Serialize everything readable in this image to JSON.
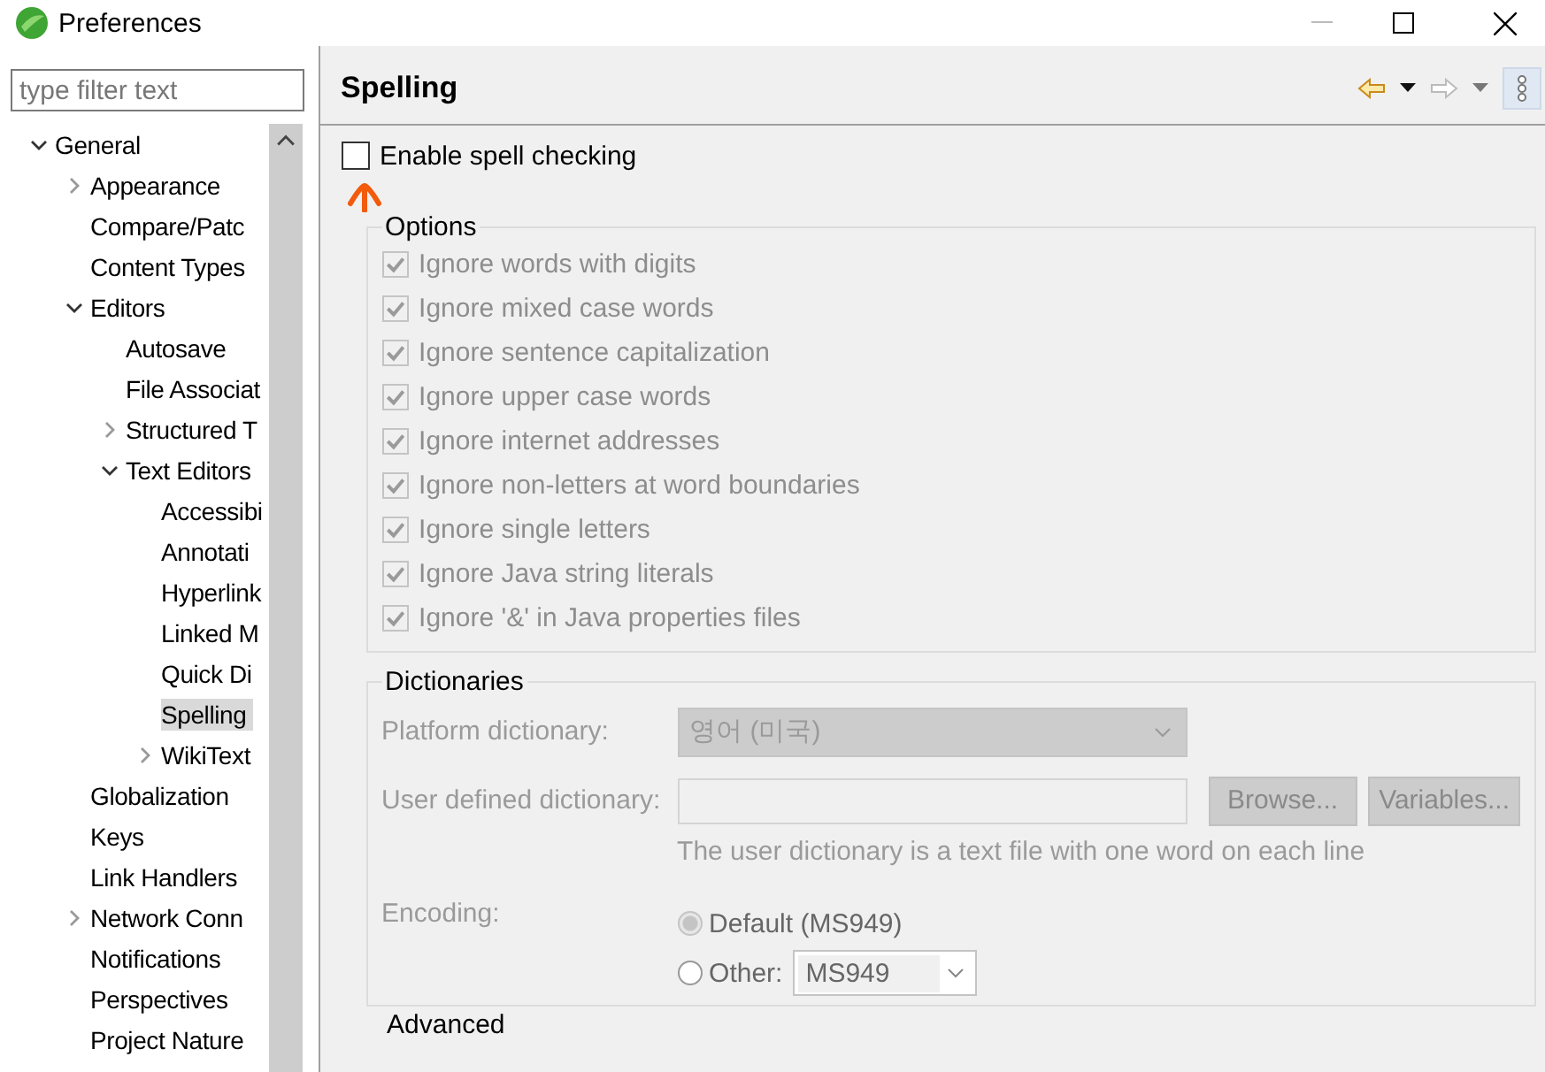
{
  "window": {
    "title": "Preferences"
  },
  "filter": {
    "placeholder": "type filter text"
  },
  "tree": [
    {
      "label": "General",
      "expanded": true,
      "selected": false,
      "children": [
        {
          "label": "Appearance",
          "expanded": false,
          "selected": false
        },
        {
          "label": "Compare/Patc",
          "selected": false
        },
        {
          "label": "Content Types",
          "selected": false
        },
        {
          "label": "Editors",
          "expanded": true,
          "selected": false,
          "children": [
            {
              "label": "Autosave",
              "selected": false
            },
            {
              "label": "File Associat",
              "selected": false
            },
            {
              "label": "Structured T",
              "expanded": false,
              "selected": false
            },
            {
              "label": "Text Editors",
              "expanded": true,
              "selected": false,
              "children": [
                {
                  "label": "Accessibi",
                  "selected": false
                },
                {
                  "label": "Annotati",
                  "selected": false
                },
                {
                  "label": "Hyperlink",
                  "selected": false
                },
                {
                  "label": "Linked M",
                  "selected": false
                },
                {
                  "label": "Quick Di",
                  "selected": false
                },
                {
                  "label": "Spelling",
                  "selected": true
                },
                {
                  "label": "WikiText",
                  "expanded": false,
                  "selected": false
                }
              ]
            }
          ]
        },
        {
          "label": "Globalization",
          "selected": false
        },
        {
          "label": "Keys",
          "selected": false
        },
        {
          "label": "Link Handlers",
          "selected": false
        },
        {
          "label": "Network Conn",
          "expanded": false,
          "selected": false
        },
        {
          "label": "Notifications",
          "selected": false
        },
        {
          "label": "Perspectives",
          "selected": false
        },
        {
          "label": "Project Nature",
          "selected": false
        }
      ]
    }
  ],
  "page": {
    "title": "Spelling",
    "enable": {
      "label": "Enable spell checking",
      "checked": false
    },
    "options": {
      "title": "Options",
      "items": [
        {
          "label": "Ignore words with digits",
          "checked": true,
          "disabled": true
        },
        {
          "label": "Ignore mixed case words",
          "checked": true,
          "disabled": true
        },
        {
          "label": "Ignore sentence capitalization",
          "checked": true,
          "disabled": true
        },
        {
          "label": "Ignore upper case words",
          "checked": true,
          "disabled": true
        },
        {
          "label": "Ignore internet addresses",
          "checked": true,
          "disabled": true
        },
        {
          "label": "Ignore non-letters at word boundaries",
          "checked": true,
          "disabled": true
        },
        {
          "label": "Ignore single letters",
          "checked": true,
          "disabled": true
        },
        {
          "label": "Ignore Java string literals",
          "checked": true,
          "disabled": true
        },
        {
          "label": "Ignore '&' in Java properties files",
          "checked": true,
          "disabled": true
        }
      ]
    },
    "dictionaries": {
      "title": "Dictionaries",
      "disabled": true,
      "platform": {
        "label": "Platform dictionary:",
        "value": "영어 (미국)"
      },
      "user": {
        "label": "User defined dictionary:",
        "buttons": [
          "Browse...",
          "Variables..."
        ],
        "hint": "The user dictionary is a text file with one word on each line"
      },
      "encoding": {
        "label": "Encoding:",
        "choices": [
          {
            "label": "Default (MS949)",
            "selected": true
          },
          {
            "label": "Other:",
            "selected": false
          }
        ],
        "other_value": "MS949"
      }
    },
    "advanced": {
      "title": "Advanced"
    }
  }
}
